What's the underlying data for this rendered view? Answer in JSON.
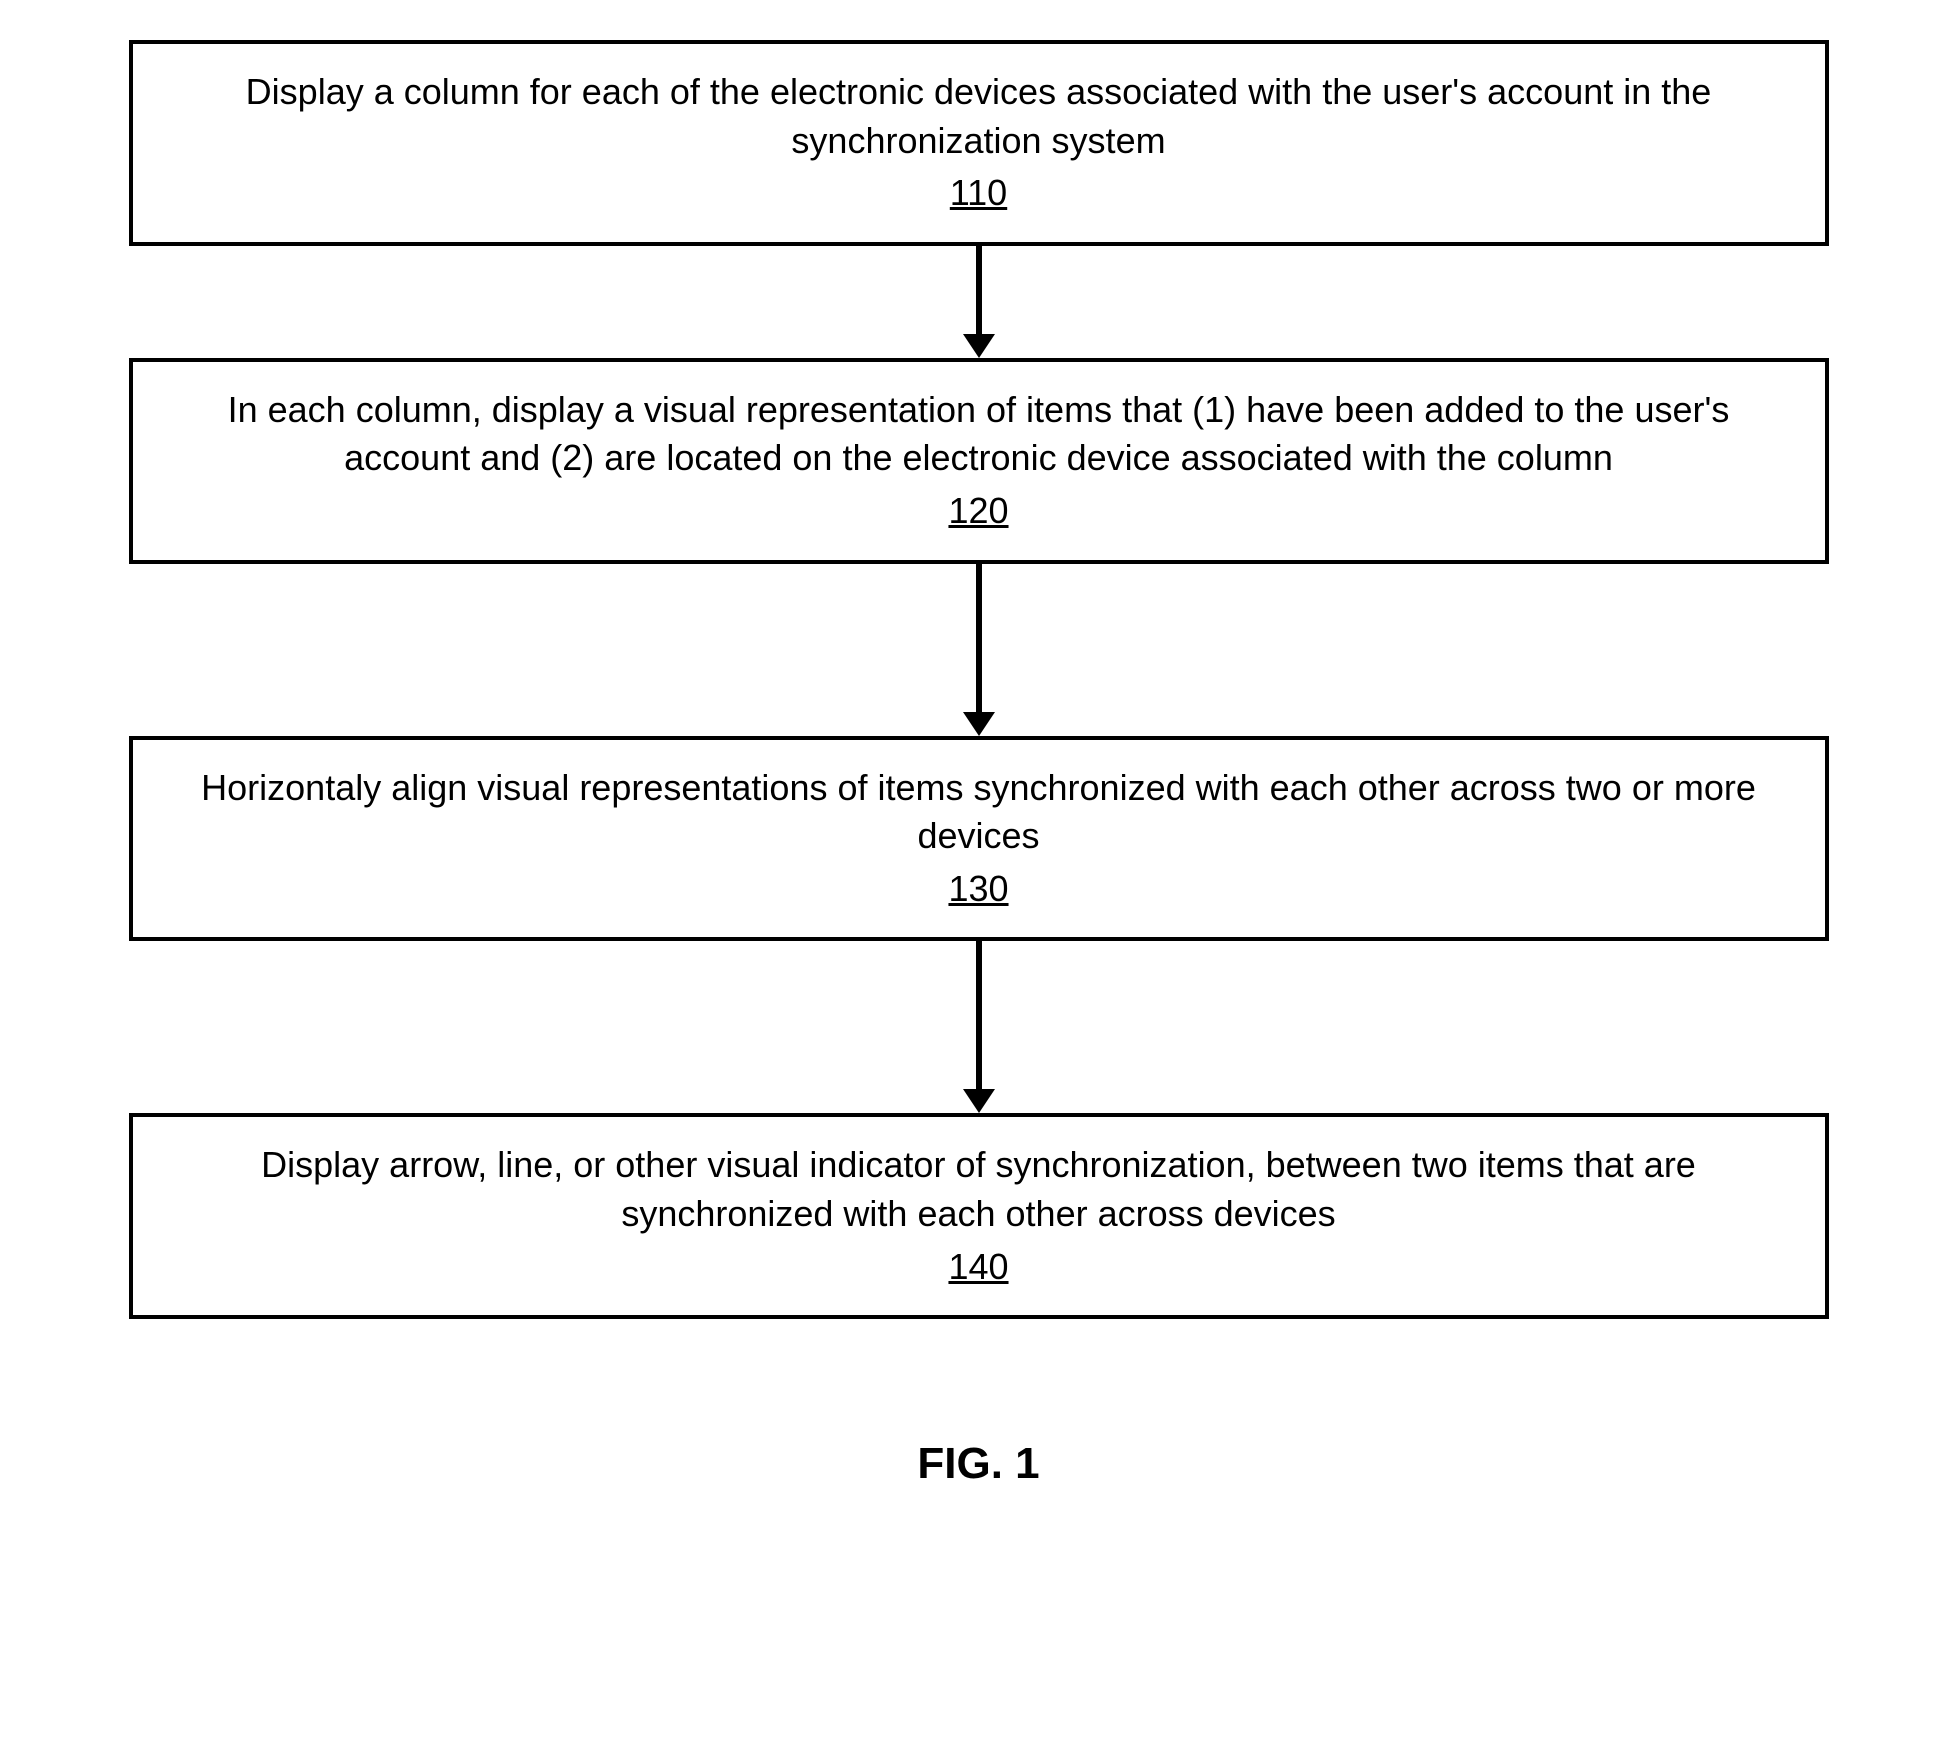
{
  "flowchart": {
    "steps": [
      {
        "text": "Display a column for each of the electronic devices associated with the user's account in the synchronization system",
        "number": "110"
      },
      {
        "text": "In each column, display a visual representation of items that (1) have been added to the user's account and (2) are located on the electronic device associated with the column",
        "number": "120"
      },
      {
        "text": "Horizontaly align visual representations of items synchronized with each other across two or more devices",
        "number": "130"
      },
      {
        "text": "Display arrow, line, or other visual indicator of synchronization, between two items that are synchronized with each other across devices",
        "number": "140"
      }
    ]
  },
  "figure_label": "FIG. 1"
}
